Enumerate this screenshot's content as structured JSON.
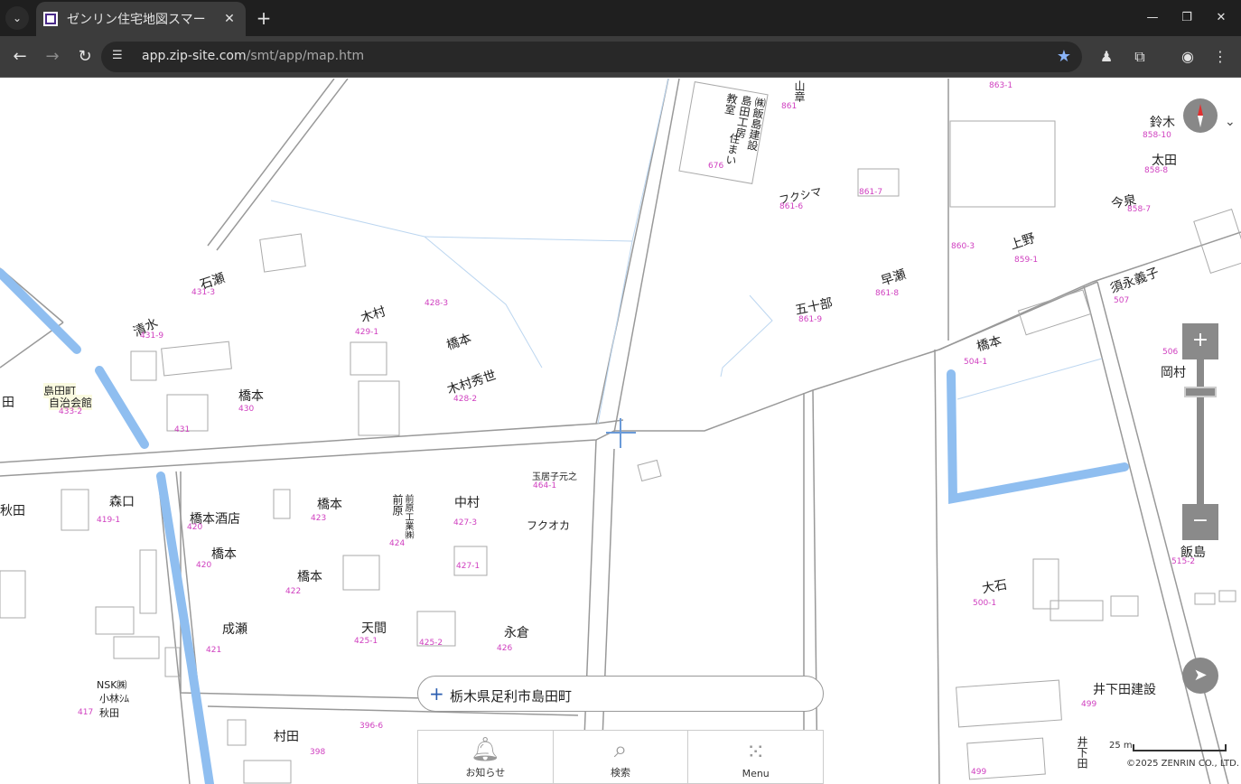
{
  "browser": {
    "tab_title": "ゼンリン住宅地図スマー",
    "url_host": "app.zip-site.com",
    "url_path": "/smt/app/map.htm"
  },
  "map": {
    "address": "栃木県足利市島田町",
    "scale_label": "25 m",
    "copyright": "©2025 ZENRIN CO., LTD.",
    "labels": {
      "kimura": "木村",
      "hashimoto1": "橋本",
      "kimura_hideyo": "木村秀世",
      "ishise": "石瀬",
      "shimizu": "清水",
      "hashimoto2": "橋本",
      "jichikaikan1": "島田町",
      "jichikaikan2": "自治会館",
      "ta": "田",
      "moriguchi": "森口",
      "aki": "秋田",
      "hashimoto_saketen": "橋本酒店",
      "hashimoto3": "橋本",
      "hashimoto4": "橋本",
      "hashimoto5": "橋本",
      "nakamura": "中村",
      "tamaiko": "玉居子元之",
      "fukuoka": "フクオカ",
      "naruse": "成瀬",
      "tenma": "天間",
      "nagakura": "永倉",
      "nsk1": "NSK㈱",
      "nsk2": "小林ｼﾑ",
      "nsk3": "秋田",
      "murata": "村田",
      "maebara": "前原",
      "maebara_kogyo": "前原工業㈱",
      "fukushima": "フクシマ",
      "isoda": "五十部",
      "hayase": "早瀬",
      "ueno": "上野",
      "suzuki": "鈴木",
      "ota": "太田",
      "imaizumi": "今泉",
      "sunaga": "須永義子",
      "hashimoto6": "橋本",
      "okamura": "岡村",
      "iijima": "飯島",
      "oishi": "大石",
      "ishita_kensetsu": "井下田建設",
      "ishita": "井下田",
      "yama": "山章",
      "iijima_kensetsu": "㈱飯島建設",
      "shimada_kobo": "島田工房",
      "kyoshitsu": "教室",
      "sumai": "住まい"
    },
    "parcels": {
      "p1": "428-3",
      "p2": "429-1",
      "p3": "428-2",
      "p4": "431-3",
      "p5": "431-9",
      "p6": "433-2",
      "p7": "430",
      "p8": "431",
      "p9": "419-1",
      "p10": "420",
      "p11": "423",
      "p12": "420",
      "p13": "422",
      "p14": "424",
      "p15": "427-3",
      "p16": "464-1",
      "p17": "427-1",
      "p18": "421",
      "p19": "425-1",
      "p20": "425-2",
      "p21": "426",
      "p22": "417",
      "p23": "396-6",
      "p24": "398",
      "p25": "861-6",
      "p26": "861-7",
      "p27": "861-9",
      "p28": "861-8",
      "p29": "860-3",
      "p30": "859-1",
      "p31": "858-10",
      "p32": "858-8",
      "p33": "858-7",
      "p34": "504-1",
      "p35": "507",
      "p36": "506",
      "p37": "500-1",
      "p38": "499",
      "p39": "499",
      "p40": "863-1",
      "p41": "861",
      "p42": "676",
      "p43": "515-2"
    }
  },
  "bottom_menu": {
    "notifications": "お知らせ",
    "search": "検索",
    "menu": "Menu"
  },
  "colors": {
    "water": "#8fbef0",
    "parcel": "#d040c0",
    "road": "#999999"
  }
}
